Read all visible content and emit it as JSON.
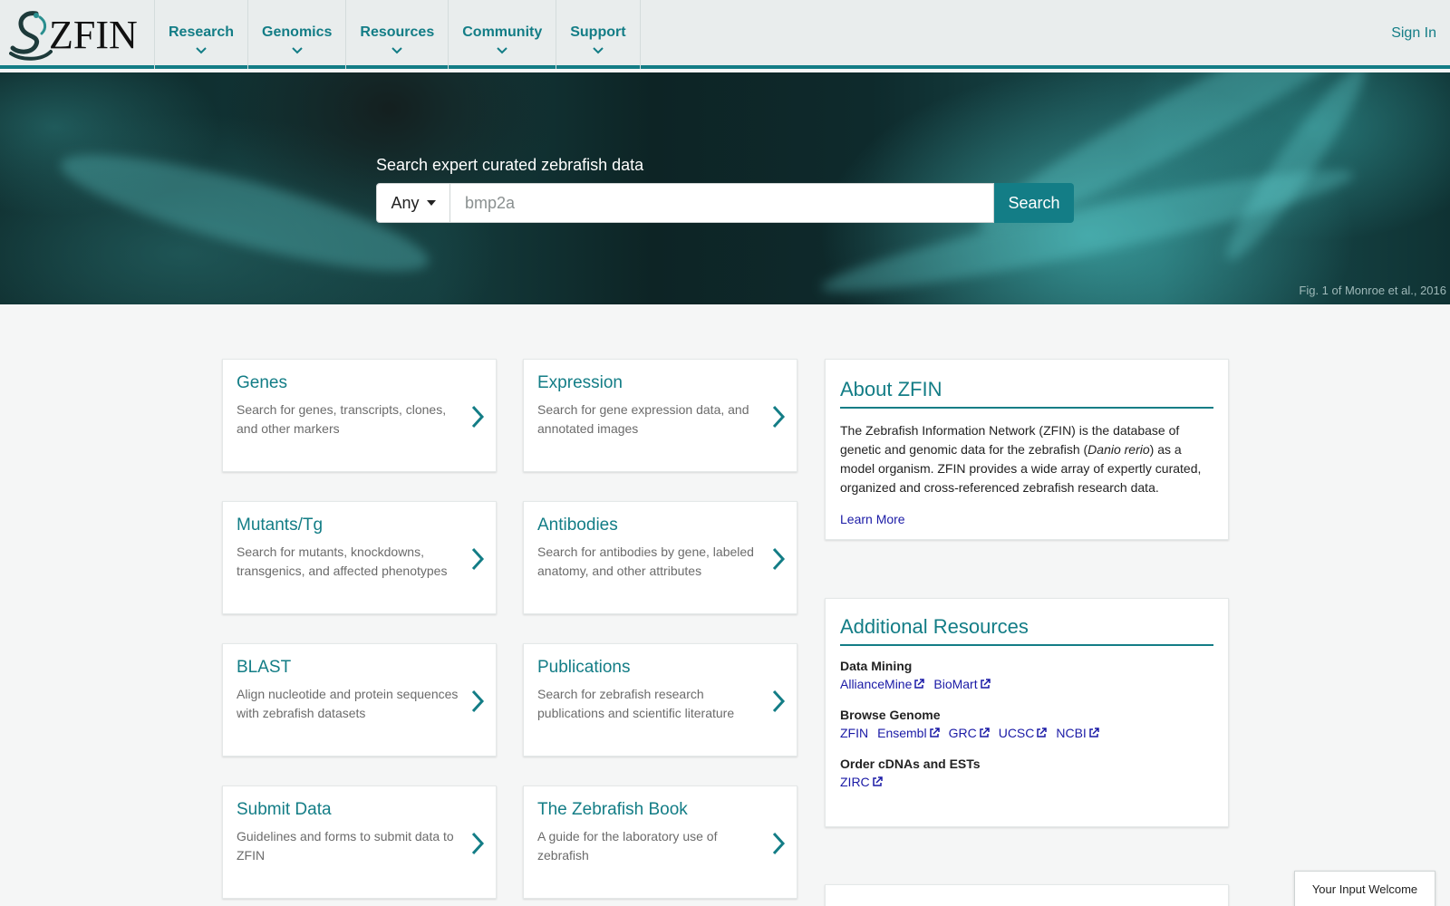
{
  "header": {
    "logo_text": "ZFIN",
    "nav": [
      {
        "label": "Research"
      },
      {
        "label": "Genomics"
      },
      {
        "label": "Resources"
      },
      {
        "label": "Community"
      },
      {
        "label": "Support"
      }
    ],
    "signin_label": "Sign In"
  },
  "hero": {
    "title": "Search expert curated zebrafish data",
    "category_selected": "Any",
    "search_placeholder": "bmp2a",
    "search_button": "Search",
    "caption": "Fig. 1 of Monroe et al., 2016"
  },
  "cards": [
    {
      "title": "Genes",
      "desc": "Search for genes, transcripts, clones, and other markers"
    },
    {
      "title": "Expression",
      "desc": "Search for gene expression data, and annotated images"
    },
    {
      "title": "Mutants/Tg",
      "desc": "Search for mutants, knockdowns, transgenics, and affected phenotypes"
    },
    {
      "title": "Antibodies",
      "desc": "Search for antibodies by gene, labeled anatomy, and other attributes"
    },
    {
      "title": "BLAST",
      "desc": "Align nucleotide and protein sequences with zebrafish datasets"
    },
    {
      "title": "Publications",
      "desc": "Search for zebrafish research publications and scientific literature"
    },
    {
      "title": "Submit Data",
      "desc": "Guidelines and forms to submit data to ZFIN"
    },
    {
      "title": "The Zebrafish Book",
      "desc": "A guide for the laboratory use of zebrafish"
    }
  ],
  "about": {
    "title": "About ZFIN",
    "text_before": "The Zebrafish Information Network (ZFIN) is the database of genetic and genomic data for the zebrafish (",
    "species": "Danio rerio",
    "text_after": ") as a model organism. ZFIN provides a wide array of expertly curated, organized and cross-referenced zebrafish research data.",
    "learn_more": "Learn More"
  },
  "resources": {
    "title": "Additional Resources",
    "groups": [
      {
        "heading": "Data Mining",
        "links": [
          "AllianceMine",
          "BioMart"
        ]
      },
      {
        "heading": "Browse Genome",
        "links": [
          "ZFIN",
          "Ensembl",
          "GRC",
          "UCSC",
          "NCBI"
        ]
      },
      {
        "heading": "Order cDNAs and ESTs",
        "links": [
          "ZIRC"
        ]
      }
    ]
  },
  "feedback_label": "Your Input Welcome",
  "colors": {
    "accent": "#137d86",
    "link": "#1a1aa6",
    "header_bg": "#e9eded"
  }
}
